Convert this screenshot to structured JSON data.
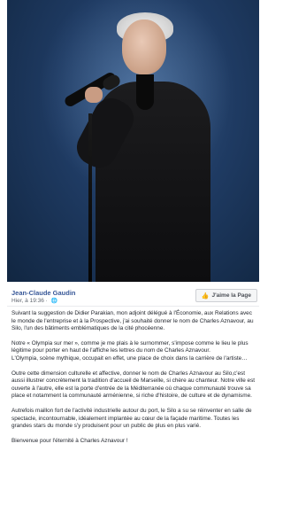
{
  "post": {
    "author": "Jean-Claude Gaudin",
    "time": "Hier, à 19:36 ·",
    "like_button_label": "J'aime la Page",
    "paragraphs": [
      "Suivant la suggestion de Didier Parakian, mon adjoint délégué à l'Économie, aux Relations avec le monde de l'entreprise et à la Prospective, j'ai souhaité donner le nom de Charles Aznavour, au Silo, l'un des bâtiments emblématiques de la cité phocéenne.",
      "Notre « Olympia sur mer », comme je me plais à le surnommer, s'impose comme le lieu le plus légitime pour porter en haut de l'affiche les lettres du nom de Charles Aznavour.\nL'Olympia, scène mythique, occupait en effet, une place de choix dans la carrière de l'artiste…",
      "Outre cette dimension culturelle et affective, donner le nom de Charles Aznavour au Silo,c'est aussi illustrer concrètement la tradition d'accueil de Marseille, si chère au chanteur. Notre ville est ouverte à l'autre, elle est la porte d'entrée de la Méditerranée où chaque communauté trouve sa place et notamment la communauté arménienne, si riche d'histoire, de culture et de dynamisme.",
      "Autrefois maillon fort de l'activité industrielle autour du port, le Silo a su se réinventer en salle de spectacle, incontournable, idéalement implantée au cœur de la façade maritime. Toutes les grandes stars du monde s'y produisent pour un public de plus en plus varié.",
      "Bienvenue pour l'éternité à Charles Aznavour !"
    ],
    "icons": {
      "globe": "globe-icon",
      "like": "thumbs-up-icon"
    }
  }
}
